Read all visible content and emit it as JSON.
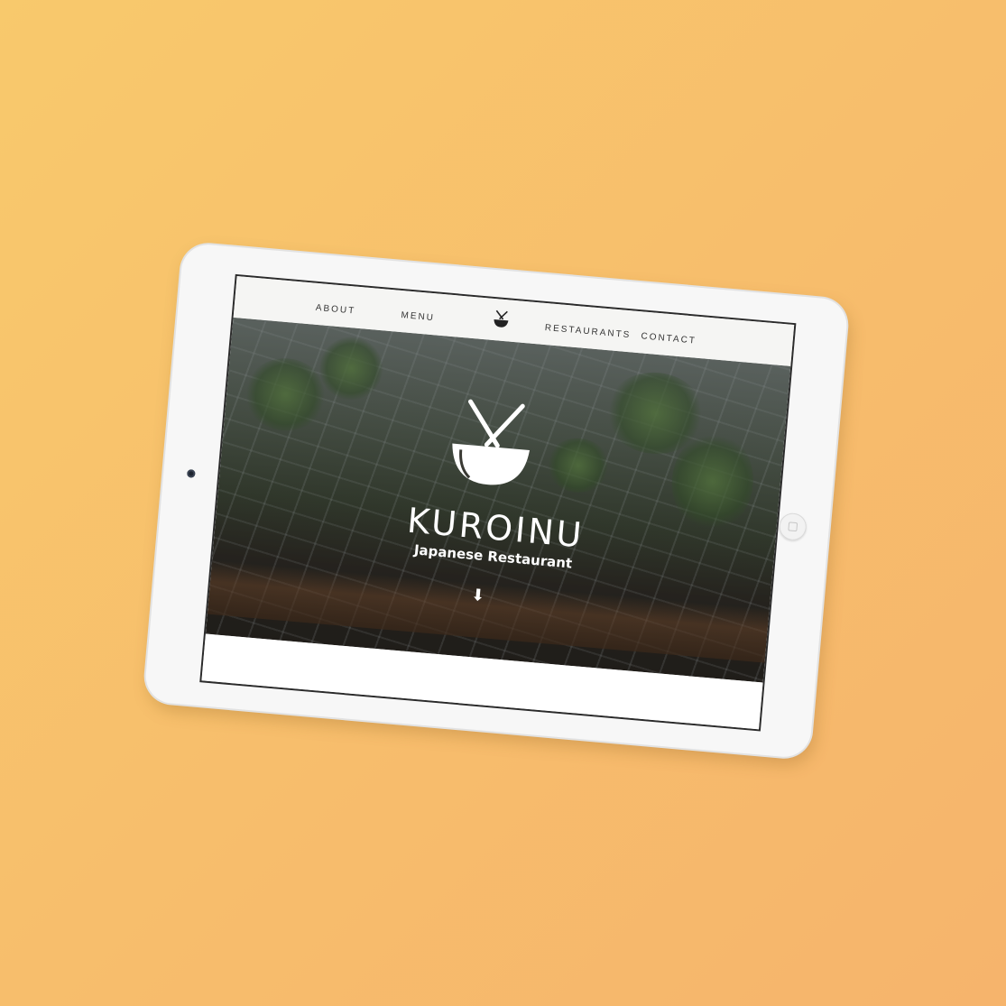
{
  "nav": {
    "about": "ABOUT",
    "menu": "MENU",
    "restaurants": "RESTAURANTS",
    "contact": "CONTACT"
  },
  "hero": {
    "title": "KUROINU",
    "subtitle": "Japanese Restaurant",
    "logo_icon": "bowl-chopsticks-icon",
    "scroll_icon": "arrow-down-icon"
  },
  "colors": {
    "background_gradient_start": "#f8c96c",
    "background_gradient_end": "#f6b46c",
    "tablet_frame": "#f7f7f7",
    "nav_background": "#f5f5f3",
    "hero_text": "#ffffff"
  }
}
